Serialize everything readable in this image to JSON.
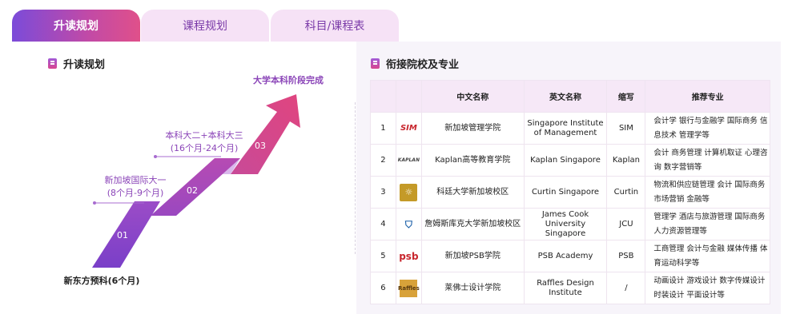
{
  "tabs": [
    {
      "label": "升读规划",
      "active": true
    },
    {
      "label": "课程规划",
      "active": false
    },
    {
      "label": "科目/课程表",
      "active": false
    }
  ],
  "left": {
    "title": "升读规划",
    "steps": [
      {
        "num": "01",
        "label": "新东方预科(6个月)"
      },
      {
        "num": "02",
        "label_line1": "新加坡国际大一",
        "label_line2": "(8个月-9个月)"
      },
      {
        "num": "03",
        "label_line1": "本科大二+本科大三",
        "label_line2": "(16个月-24个月)"
      },
      {
        "label": "大学本科阶段完成"
      }
    ]
  },
  "right": {
    "title": "衔接院校及专业",
    "headers": [
      "",
      "",
      "中文名称",
      "英文名称",
      "缩写",
      "推荐专业"
    ],
    "rows": [
      {
        "no": "1",
        "logo": "SIM",
        "cn": "新加坡管理学院",
        "en": "Singapore Institute of Management",
        "abbr": "SIM",
        "majors": "会计学 银行与金融学 国际商务 信息技术 管理学等"
      },
      {
        "no": "2",
        "logo": "KAPLAN",
        "cn": "Kaplan高等教育学院",
        "en": "Kaplan Singapore",
        "abbr": "Kaplan",
        "majors": "会计 商务管理 计算机取证 心理咨询 数字营销等"
      },
      {
        "no": "3",
        "logo": "Curtin",
        "cn": "科廷大学新加坡校区",
        "en": "Curtin Singapore",
        "abbr": "Curtin",
        "majors": "物流和供应链管理 会计 国际商务 市场营销 金融等"
      },
      {
        "no": "4",
        "logo": "JCU",
        "cn": "詹姆斯库克大学新加坡校区",
        "en": "James Cook University Singapore",
        "abbr": "JCU",
        "majors": "管理学 酒店与旅游管理 国际商务 人力资源管理等"
      },
      {
        "no": "5",
        "logo": "psb",
        "cn": "新加坡PSB学院",
        "en": "PSB Academy",
        "abbr": "PSB",
        "majors": "工商管理 会计与金融 媒体传播 体育运动科学等"
      },
      {
        "no": "6",
        "logo": "Raffles",
        "cn": "莱佛士设计学院",
        "en": "Raffles Design Institute",
        "abbr": "/",
        "majors": "动画设计 游戏设计 数字传媒设计 时装设计 平面设计等"
      }
    ]
  },
  "colors": {
    "accent_purple": "#7b4bd9",
    "accent_pink": "#d8458f",
    "tab_bg": "#f6e2f6"
  }
}
